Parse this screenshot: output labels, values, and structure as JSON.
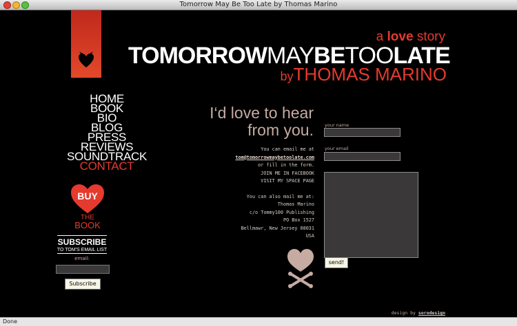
{
  "window": {
    "title": "Tomorrow May Be Too Late by Thomas Marino"
  },
  "status": {
    "text": "Done"
  },
  "branding": {
    "tagline_pre": "a",
    "tagline_bold": "love",
    "tagline_post": "story",
    "logo_part1": "TOMORROW",
    "logo_part2": "MAY",
    "logo_part3": "BE",
    "logo_part4": "TOO",
    "logo_part5": "LATE",
    "byline_by": "by",
    "byline_name": "THOMAS MARINO"
  },
  "nav": {
    "items": [
      {
        "label": "HOME"
      },
      {
        "label": "BOOK"
      },
      {
        "label": "BIO"
      },
      {
        "label": "BLOG"
      },
      {
        "label": "PRESS"
      },
      {
        "label": "REVIEWS"
      },
      {
        "label": "SOUNDTRACK"
      },
      {
        "label": "CONTACT"
      }
    ]
  },
  "buy": {
    "word": "BUY",
    "the": "THE",
    "book": "BOOK"
  },
  "subscribe": {
    "title": "SUBSCRIBE",
    "subtitle": "TO TOM'S EMAIL LIST",
    "email_label": "email:",
    "button": "Subscribe"
  },
  "contact": {
    "heading_line1": "I‘d love to hear",
    "heading_line2": "from you.",
    "intro": "You can email me at",
    "email": "tom@tomorrowmaybetoolate.com",
    "or_form": "or fill in the form.",
    "facebook": "JOIN ME IN FACEBOOK",
    "myspace": "VISIT MY SPACE PAGE",
    "mail_intro": "You can also mail me at:",
    "address": [
      "Thomas Marino",
      "c/o Tommy100 Publishing",
      "PO Box 1527",
      "Bellmawr, New Jersey 08031",
      "USA"
    ]
  },
  "form": {
    "name_label": "your name",
    "email_label": "your email",
    "send_button": "send!"
  },
  "footer": {
    "design_by": "design by",
    "designer": "sorodesign"
  },
  "colors": {
    "accent": "#e53a2e",
    "muted_pink": "#c6aba2",
    "background": "#000000"
  }
}
